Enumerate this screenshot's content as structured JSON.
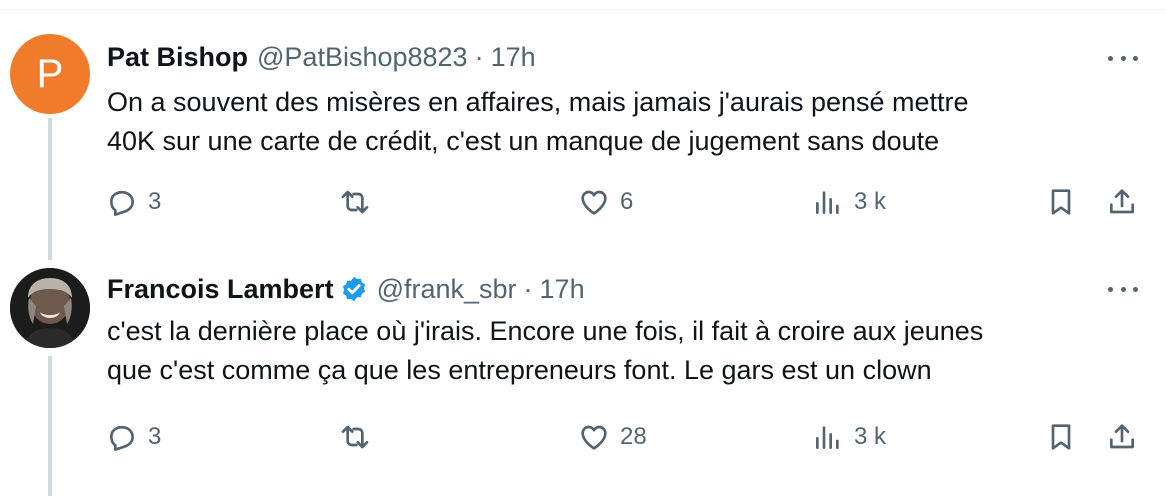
{
  "tweets": [
    {
      "avatar_letter": "P",
      "name": "Pat Bishop",
      "handle": "@PatBishop8823",
      "separator": "·",
      "time": "17h",
      "verified": false,
      "text_lines": [
        "On a souvent des misères en affaires, mais jamais j'aurais pensé mettre",
        "40K sur une carte de crédit, c'est un manque de jugement sans doute"
      ],
      "replies": "3",
      "retweets": "",
      "likes": "6",
      "views": "3 k"
    },
    {
      "avatar_letter": "",
      "name": "Francois Lambert",
      "handle": "@frank_sbr",
      "separator": "·",
      "time": "17h",
      "verified": true,
      "text_lines": [
        "c'est la dernière place où j'irais. Encore une fois, il fait à croire aux jeunes",
        "que c'est comme ça que les entrepreneurs font. Le gars est un clown"
      ],
      "replies": "3",
      "retweets": "",
      "likes": "28",
      "views": "3 k"
    }
  ],
  "colors": {
    "avatar_orange": "#f07c2b",
    "verified_blue": "#1d9bf0",
    "muted_text": "#536471",
    "thread_line": "#cfd9de"
  }
}
